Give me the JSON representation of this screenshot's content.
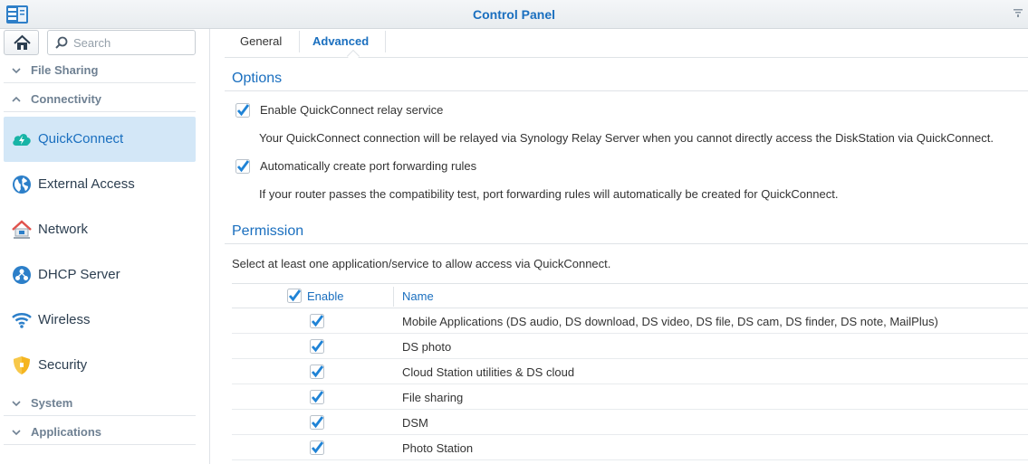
{
  "window": {
    "title": "Control Panel"
  },
  "search": {
    "placeholder": "Search"
  },
  "sidebar": {
    "groups": {
      "file_sharing": "File Sharing",
      "connectivity": "Connectivity",
      "system": "System",
      "applications": "Applications"
    },
    "items": [
      {
        "label": "QuickConnect",
        "icon": "cloud-icon",
        "active": true
      },
      {
        "label": "External Access",
        "icon": "globe-icon",
        "active": false
      },
      {
        "label": "Network",
        "icon": "house-network-icon",
        "active": false
      },
      {
        "label": "DHCP Server",
        "icon": "dhcp-icon",
        "active": false
      },
      {
        "label": "Wireless",
        "icon": "wifi-icon",
        "active": false
      },
      {
        "label": "Security",
        "icon": "shield-icon",
        "active": false
      }
    ]
  },
  "tabs": [
    {
      "label": "General",
      "active": false
    },
    {
      "label": "Advanced",
      "active": true
    }
  ],
  "options": {
    "title": "Options",
    "relay_label": "Enable QuickConnect relay service",
    "relay_checked": true,
    "relay_desc": "Your QuickConnect connection will be relayed via Synology Relay Server when you cannot directly access the DiskStation via QuickConnect.",
    "portfwd_label": "Automatically create port forwarding rules",
    "portfwd_checked": true,
    "portfwd_desc": "If your router passes the compatibility test, port forwarding rules will automatically be created for QuickConnect."
  },
  "permission": {
    "title": "Permission",
    "desc": "Select at least one application/service to allow access via QuickConnect.",
    "columns": {
      "enable": "Enable",
      "name": "Name"
    },
    "rows": [
      {
        "name": "Mobile Applications (DS audio, DS download, DS video, DS file, DS cam, DS finder, DS note, MailPlus)",
        "enabled": true
      },
      {
        "name": "DS photo",
        "enabled": true
      },
      {
        "name": "Cloud Station utilities & DS cloud",
        "enabled": true
      },
      {
        "name": "File sharing",
        "enabled": true
      },
      {
        "name": "DSM",
        "enabled": true
      },
      {
        "name": "Photo Station",
        "enabled": true
      }
    ]
  },
  "colors": {
    "accent": "#1a6fbf",
    "active_bg": "#d3e7f7",
    "check": "#1f83d6"
  }
}
